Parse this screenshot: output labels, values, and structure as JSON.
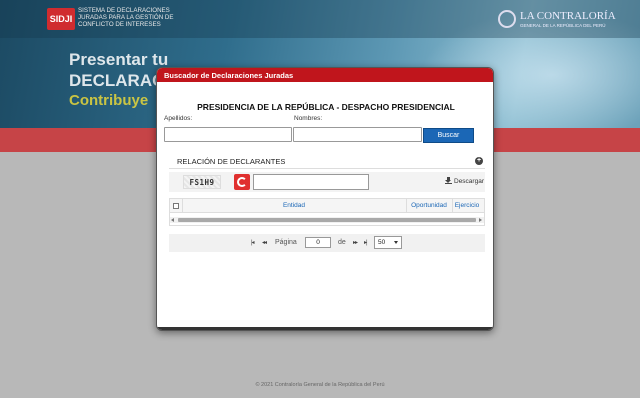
{
  "background": {
    "logo": {
      "mark": "SIDJI",
      "text": "SISTEMA DE DECLARACIONES JURADAS PARA LA GESTIÓN DE CONFLICTO DE INTERESES"
    },
    "brand": {
      "name": "LA CONTRALORÍA",
      "sub": "GENERAL DE LA REPÚBLICA DEL PERÚ"
    },
    "hero": {
      "line1": "Presentar tu",
      "line2": "DECLARACI",
      "line3": "Contribuye"
    },
    "footer": "© 2021 Contraloría General de la República del Perú"
  },
  "modal": {
    "header_title": "Buscador de Declaraciones Juradas",
    "entity_title": "PRESIDENCIA DE LA REPÚBLICA - DESPACHO PRESIDENCIAL",
    "apellidos_label": "Apellidos:",
    "apellidos_value": "",
    "nombres_label": "Nombres:",
    "nombres_value": "",
    "buscar_label": "Buscar",
    "section_title": "RELACIÓN DE DECLARANTES",
    "captcha_text": "FS1H9",
    "captcha_input_value": "",
    "descargar_label": "Descargar",
    "grid": {
      "columns": [
        "Entidad",
        "Oportunidad",
        "Ejercicio"
      ]
    },
    "pager": {
      "page_label": "Página",
      "of_label": "de",
      "page_value": "0",
      "page_size": "50"
    }
  }
}
